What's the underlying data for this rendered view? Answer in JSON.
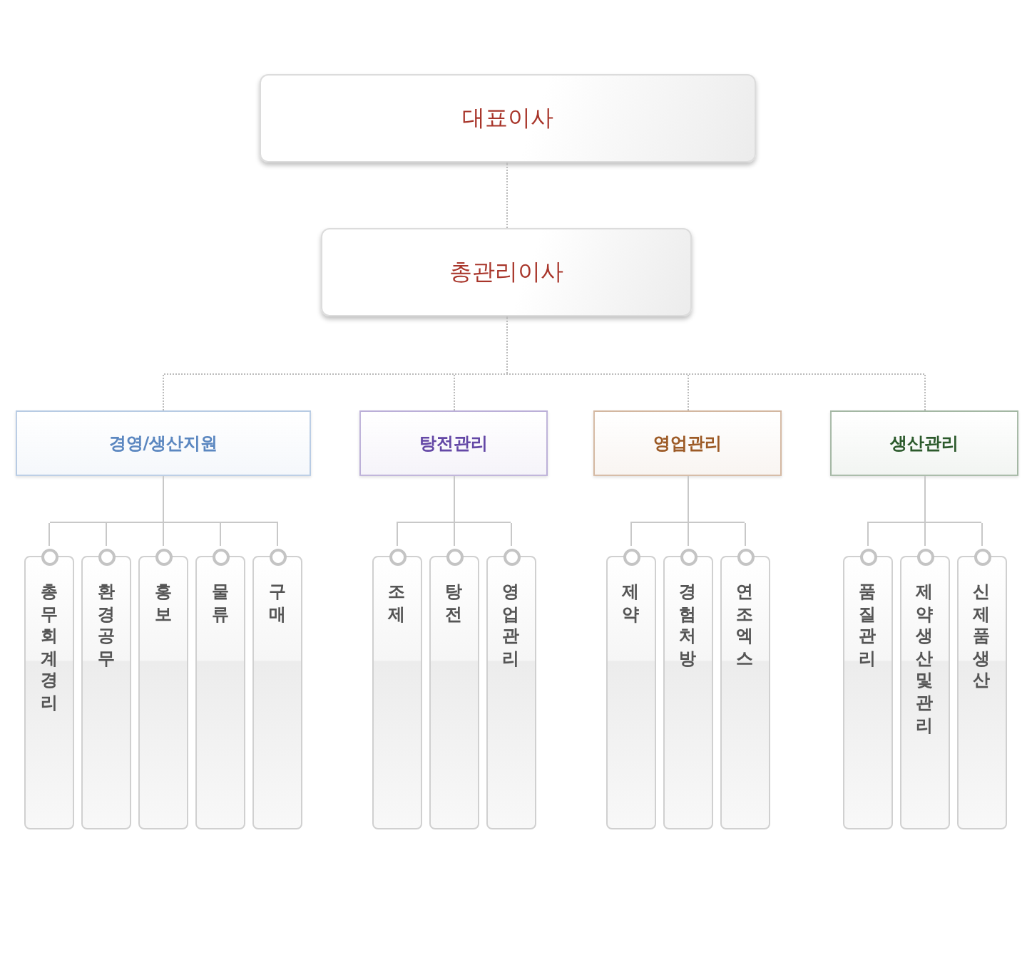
{
  "ceo": {
    "title": "대표이사"
  },
  "general_director": {
    "title": "총관리이사"
  },
  "divisions": [
    {
      "title": "경영/생산지원",
      "color": "#5b87c0",
      "teams": [
        "총무 회계 경리",
        "환경 공무",
        "홍보",
        "물류",
        "구매"
      ]
    },
    {
      "title": "탕전관리",
      "color": "#6448a6",
      "teams": [
        "조제",
        "탕전",
        "영업관리"
      ]
    },
    {
      "title": "영업관리",
      "color": "#9c5a26",
      "teams": [
        "제약",
        "경험처방",
        "연조엑스"
      ]
    },
    {
      "title": "생산관리",
      "color": "#2c5a2c",
      "teams": [
        "품질관리",
        "제약생산 및 관리",
        "신제품생산"
      ]
    }
  ]
}
